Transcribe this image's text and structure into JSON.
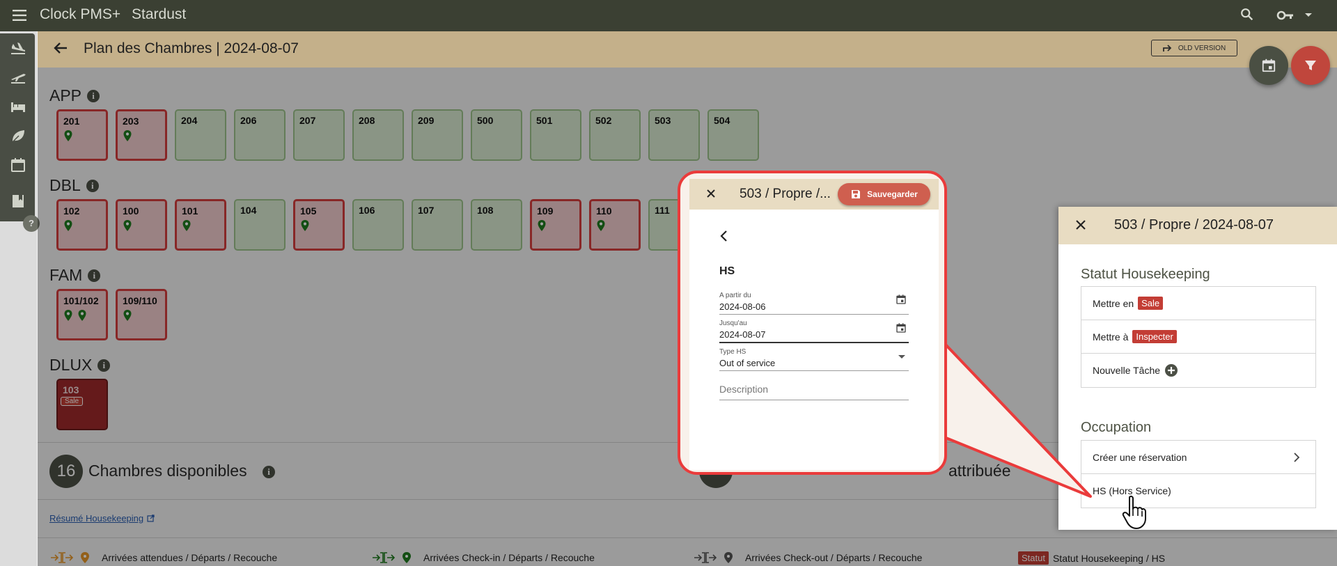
{
  "app": {
    "name": "Clock PMS+",
    "property": "Stardust"
  },
  "header": {
    "title": "Plan des Chambres | 2024-08-07",
    "old_version_label": "OLD VERSION"
  },
  "groups": [
    {
      "name": "APP",
      "rooms": [
        {
          "n": "201",
          "state": "dirty",
          "pins": 1
        },
        {
          "n": "203",
          "state": "dirty",
          "pins": 1
        },
        {
          "n": "204",
          "state": "clean",
          "pins": 0
        },
        {
          "n": "206",
          "state": "clean",
          "pins": 0
        },
        {
          "n": "207",
          "state": "clean",
          "pins": 0
        },
        {
          "n": "208",
          "state": "clean",
          "pins": 0
        },
        {
          "n": "209",
          "state": "clean",
          "pins": 0
        },
        {
          "n": "500",
          "state": "clean",
          "pins": 0
        },
        {
          "n": "501",
          "state": "clean",
          "pins": 0
        },
        {
          "n": "502",
          "state": "clean",
          "pins": 0
        },
        {
          "n": "503",
          "state": "clean",
          "pins": 0
        },
        {
          "n": "504",
          "state": "clean",
          "pins": 0
        }
      ]
    },
    {
      "name": "DBL",
      "rooms": [
        {
          "n": "102",
          "state": "dirty",
          "pins": 1
        },
        {
          "n": "100",
          "state": "dirty",
          "pins": 1
        },
        {
          "n": "101",
          "state": "dirty",
          "pins": 1
        },
        {
          "n": "104",
          "state": "clean",
          "pins": 0
        },
        {
          "n": "105",
          "state": "dirty",
          "pins": 1
        },
        {
          "n": "106",
          "state": "clean",
          "pins": 0
        },
        {
          "n": "107",
          "state": "clean",
          "pins": 0
        },
        {
          "n": "108",
          "state": "clean",
          "pins": 0
        },
        {
          "n": "109",
          "state": "dirty",
          "pins": 1
        },
        {
          "n": "110",
          "state": "dirty",
          "pins": 1
        },
        {
          "n": "111",
          "state": "clean",
          "pins": 0
        }
      ]
    },
    {
      "name": "FAM",
      "rooms": [
        {
          "n": "101/102",
          "state": "dirty",
          "pins": 2
        },
        {
          "n": "109/110",
          "state": "dirty",
          "pins": 1
        }
      ]
    },
    {
      "name": "DLUX",
      "rooms": [
        {
          "n": "103",
          "state": "dark",
          "pins": 0,
          "badge": "Sale"
        }
      ]
    }
  ],
  "summary": {
    "available_count": "16",
    "available_label": "Chambres disponibles",
    "assigned_label_fragment": "attribuée",
    "housekeeping_link": "Résumé Housekeeping"
  },
  "legend": {
    "expected": "Arrivées attendues / Départs / Recouche",
    "checkin": "Arrivées Check-in / Départs / Recouche",
    "checkout": "Arrivées Check-out / Départs / Recouche",
    "status_tag": "Statut",
    "status_text": "Statut Housekeeping / HS"
  },
  "drawer": {
    "title": "503 / Propre / 2024-08-07",
    "hk_title": "Statut Housekeeping",
    "set_dirty_prefix": "Mettre en",
    "set_dirty_tag": "Sale",
    "set_inspect_prefix": "Mettre à",
    "set_inspect_tag": "Inspecter",
    "new_task": "Nouvelle Tâche",
    "occupation_title": "Occupation",
    "create_reservation": "Créer une réservation",
    "out_of_service": "HS (Hors Service)"
  },
  "dialog": {
    "title": "503 / Propre /...",
    "save_label": "Sauvegarder",
    "section": "HS",
    "from_label": "A partir du",
    "from_value": "2024-08-06",
    "until_label": "Jusqu'au",
    "until_value": "2024-08-07",
    "type_label": "Type HS",
    "type_value": "Out of service",
    "description_placeholder": "Description"
  },
  "colors": {
    "topbar": "#3b4033",
    "header": "#c4b08a",
    "dirty": "#d53d3d",
    "clean": "#9cc38a",
    "pin": "#1f7a1f",
    "accent_red": "#c33d35",
    "callout_border": "#ea3b3b"
  }
}
